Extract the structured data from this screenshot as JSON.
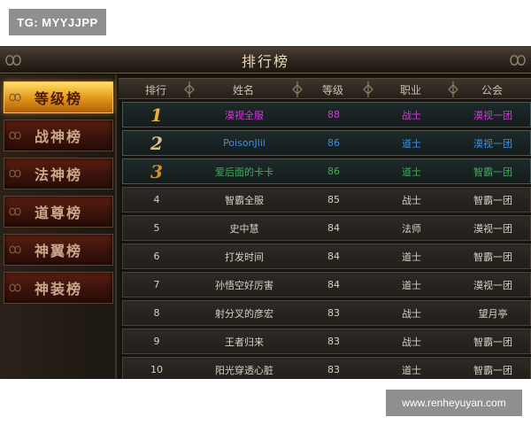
{
  "watermark_top": "TG: MYYJJPP",
  "watermark_bottom": "www.renheyuyan.com",
  "window": {
    "title": "排行榜"
  },
  "sidebar": {
    "tabs": [
      {
        "label": "等级榜",
        "active": true
      },
      {
        "label": "战神榜",
        "active": false
      },
      {
        "label": "法神榜",
        "active": false
      },
      {
        "label": "道尊榜",
        "active": false
      },
      {
        "label": "神翼榜",
        "active": false
      },
      {
        "label": "神装榜",
        "active": false
      }
    ]
  },
  "table": {
    "headers": [
      "排行",
      "姓名",
      "等级",
      "职业",
      "公会"
    ],
    "rows": [
      {
        "rank": "1",
        "name": "漠视全服",
        "level": "88",
        "job": "战士",
        "guild": "漠视一团",
        "color": "#d23ad8",
        "medal_color": "#e7b23a"
      },
      {
        "rank": "2",
        "name": "PoisonJlii",
        "level": "86",
        "job": "道士",
        "guild": "漠视一团",
        "color": "#3a8fe8",
        "medal_color": "#d9c08a"
      },
      {
        "rank": "3",
        "name": "爱后面的卡卡",
        "level": "86",
        "job": "道士",
        "guild": "智霸一团",
        "color": "#3fae5a",
        "medal_color": "#d58a2c"
      },
      {
        "rank": "4",
        "name": "智霸全服",
        "level": "85",
        "job": "战士",
        "guild": "智霸一团",
        "color": "#d6d0c6"
      },
      {
        "rank": "5",
        "name": "史中慧",
        "level": "84",
        "job": "法师",
        "guild": "漠视一团",
        "color": "#d6d0c6"
      },
      {
        "rank": "6",
        "name": "打发时间",
        "level": "84",
        "job": "道士",
        "guild": "智霸一团",
        "color": "#d6d0c6"
      },
      {
        "rank": "7",
        "name": "孙悟空好厉害",
        "level": "84",
        "job": "道士",
        "guild": "漠视一团",
        "color": "#d6d0c6"
      },
      {
        "rank": "8",
        "name": "射分叉的彦宏",
        "level": "83",
        "job": "战士",
        "guild": "望月亭",
        "color": "#d6d0c6"
      },
      {
        "rank": "9",
        "name": "王者归来",
        "level": "83",
        "job": "战士",
        "guild": "智霸一团",
        "color": "#d6d0c6"
      },
      {
        "rank": "10",
        "name": "阳光穿透心脏",
        "level": "83",
        "job": "道士",
        "guild": "智霸一团",
        "color": "#d6d0c6"
      }
    ]
  }
}
